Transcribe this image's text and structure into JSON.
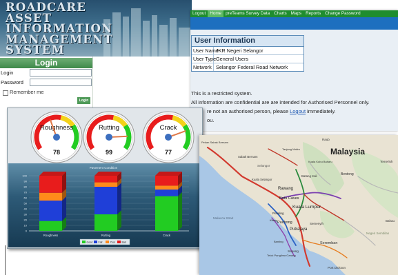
{
  "app": {
    "title_lines": [
      "ROADCARE",
      "ASSET",
      "INFORMATION",
      "MANAGEMENT",
      "SYSTEM"
    ]
  },
  "login": {
    "heading": "Login",
    "login_label": "Login",
    "password_label": "Password",
    "remember_label": "Remember me",
    "submit_label": "Login"
  },
  "nav": {
    "items": [
      "Logout",
      "Home",
      "preTeams Survey Data",
      "Charts",
      "Maps",
      "Reports",
      "Change Password"
    ],
    "active": "Home"
  },
  "user_info": {
    "heading": "User Information",
    "rows": [
      {
        "key": "User Name",
        "value": "JKR Negeri Selangor"
      },
      {
        "key": "User Type",
        "value": "General Users"
      },
      {
        "key": "Network",
        "value": "Selangor Federal Road Network"
      }
    ]
  },
  "notices": {
    "line1": "This is a restricted system.",
    "line2": "All information are confidential are are intended for Authorised Personnel only.",
    "line3_before": "re not an authorised person, please",
    "line3_link": "Logout",
    "line3_after": "immediately.",
    "line4": "ou."
  },
  "gauges": [
    {
      "label": "Roughness",
      "value": "78",
      "level": 0.42
    },
    {
      "label": "Rutting",
      "value": "99",
      "level": 0.85
    },
    {
      "label": "Crack",
      "value": "77",
      "level": 0.78
    }
  ],
  "colors": {
    "nav_green": "#1f8d2f",
    "band_blue": "#1d6fbf",
    "good": "#22cc22",
    "fair": "#1f3fd8",
    "poor": "#ff8a1a",
    "bad": "#e81c1c"
  },
  "chart_data": {
    "type": "bar",
    "stacked": true,
    "title": "Pavement Condition",
    "categories": [
      "Roughness",
      "Rutting",
      "Crack"
    ],
    "series": [
      {
        "name": "Good",
        "color": "#22cc22",
        "values": [
          18,
          30,
          63
        ]
      },
      {
        "name": "Fair",
        "color": "#1f3fd8",
        "values": [
          37,
          50,
          12
        ]
      },
      {
        "name": "Poor",
        "color": "#ff8a1a",
        "values": [
          14,
          8,
          7
        ]
      },
      {
        "name": "Bad",
        "color": "#e81c1c",
        "values": [
          31,
          12,
          18
        ]
      }
    ],
    "yticks": [
      "0",
      "10",
      "20",
      "30",
      "40",
      "50",
      "60",
      "70",
      "80",
      "90",
      "100"
    ],
    "ylim": [
      0,
      100
    ],
    "legend": "bottom"
  },
  "map": {
    "labels": [
      {
        "text": "Malaysia",
        "kind": "country"
      },
      {
        "text": "Pekan Sabak Bernam",
        "kind": "town"
      },
      {
        "text": "Sabak Bernam",
        "kind": "town"
      },
      {
        "text": "Selangor",
        "kind": "state"
      },
      {
        "text": "Kuala Selangor",
        "kind": "town"
      },
      {
        "text": "Rawang",
        "kind": "town"
      },
      {
        "text": "Batu Caves",
        "kind": "town"
      },
      {
        "text": "Kuala Lumpur",
        "kind": "city"
      },
      {
        "text": "Petaling",
        "kind": "town"
      },
      {
        "text": "Puchong",
        "kind": "town"
      },
      {
        "text": "Putrajaya",
        "kind": "town"
      },
      {
        "text": "Klang",
        "kind": "town"
      },
      {
        "text": "Malacca Strait",
        "kind": "sea"
      },
      {
        "text": "Bentong",
        "kind": "town"
      },
      {
        "text": "Batang Kali",
        "kind": "town"
      },
      {
        "text": "Kuala Kubu Baharu",
        "kind": "town"
      },
      {
        "text": "Tanjung Malim",
        "kind": "town"
      },
      {
        "text": "Raub",
        "kind": "town"
      },
      {
        "text": "Semenyih",
        "kind": "town"
      },
      {
        "text": "Seremban",
        "kind": "town"
      },
      {
        "text": "Negeri Sembilan",
        "kind": "state"
      },
      {
        "text": "Sepang",
        "kind": "town"
      },
      {
        "text": "Port Dickson",
        "kind": "town"
      },
      {
        "text": "Banting",
        "kind": "town"
      },
      {
        "text": "Telok Panglima Garang",
        "kind": "town"
      },
      {
        "text": "Temerloh",
        "kind": "town"
      },
      {
        "text": "Bahau",
        "kind": "town"
      }
    ]
  }
}
